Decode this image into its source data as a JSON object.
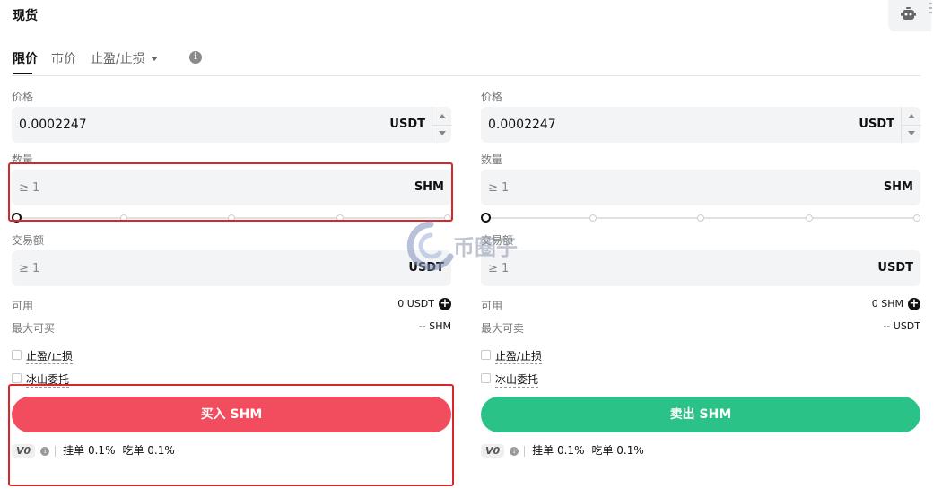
{
  "header": {
    "title": "现货",
    "bot_icon": "robot-icon"
  },
  "tabs": [
    {
      "label": "限价",
      "active": true
    },
    {
      "label": "市价",
      "active": false
    },
    {
      "label": "止盈/止损",
      "active": false,
      "dropdown": true
    }
  ],
  "tab_info_icon": "i",
  "buy": {
    "price_label": "价格",
    "price_value": "0.0002247",
    "price_unit": "USDT",
    "qty_label": "数量",
    "qty_placeholder": "≥ 1",
    "qty_unit": "SHM",
    "slider_percent": 0,
    "amount_label": "交易额",
    "amount_placeholder": "≥ 1",
    "amount_unit": "USDT",
    "available_label": "可用",
    "available_value": "0 USDT",
    "max_label": "最大可买",
    "max_value": "-- SHM",
    "tpsl_label": "止盈/止损",
    "iceberg_label": "冰山委托",
    "action_label": "买入 SHM",
    "vip_label": "V0",
    "maker_fee": "挂单 0.1%",
    "taker_fee": "吃单 0.1%"
  },
  "sell": {
    "price_label": "价格",
    "price_value": "0.0002247",
    "price_unit": "USDT",
    "qty_label": "数量",
    "qty_placeholder": "≥ 1",
    "qty_unit": "SHM",
    "slider_percent": 0,
    "amount_label": "交易额",
    "amount_placeholder": "≥ 1",
    "amount_unit": "USDT",
    "available_label": "可用",
    "available_value": "0 SHM",
    "max_label": "最大可卖",
    "max_value": "-- USDT",
    "tpsl_label": "止盈/止损",
    "iceberg_label": "冰山委托",
    "action_label": "卖出 SHM",
    "vip_label": "V0",
    "maker_fee": "挂单 0.1%",
    "taker_fee": "吃单 0.1%"
  },
  "watermark_text": "币圈子",
  "colors": {
    "buy": "#f24d5e",
    "sell": "#2bc287",
    "highlight": "#d8262b"
  }
}
